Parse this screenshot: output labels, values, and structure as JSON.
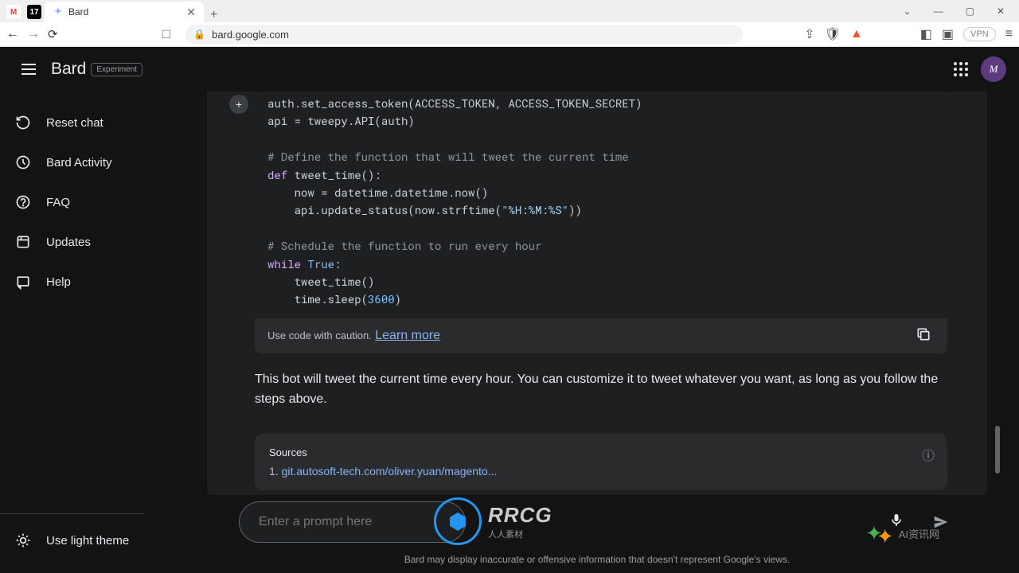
{
  "browser": {
    "tab_title": "Bard",
    "url": "bard.google.com",
    "vpn_label": "VPN"
  },
  "header": {
    "brand": "Bard",
    "badge": "Experiment",
    "avatar_letter": "M"
  },
  "sidebar": {
    "items": [
      {
        "label": "Reset chat"
      },
      {
        "label": "Bard Activity"
      },
      {
        "label": "FAQ"
      },
      {
        "label": "Updates"
      },
      {
        "label": "Help"
      }
    ],
    "theme_label": "Use light theme"
  },
  "code": {
    "line1a": "auth.set_access_token(ACCESS_TOKEN, ACCESS_TOKEN_SECRET)",
    "line2": "api = tweepy.API(auth)",
    "comment1": "# Define the function that will tweet the current time",
    "def_kw": "def",
    "func_name": " tweet_time():",
    "line5": "    now = datetime.datetime.now()",
    "line6a": "    api.update_status(now.strftime(",
    "line6_str": "\"%H:%M:%S\"",
    "line6b": "))",
    "comment2": "# Schedule the function to run every hour",
    "while_kw": "while",
    "true_kw": " True",
    "colon": ":",
    "line9": "    tweet_time()",
    "line10a": "    time.sleep(",
    "line10_num": "3600",
    "line10b": ")"
  },
  "code_footer": {
    "caution": "Use code with caution.",
    "learn": "Learn more"
  },
  "response": {
    "text": "This bot will tweet the current time every hour. You can customize it to tweet whatever you want, as long as you follow the steps above."
  },
  "sources": {
    "title": "Sources",
    "prefix": "1. ",
    "link": "git.autosoft-tech.com/oliver.yuan/magento..."
  },
  "input": {
    "placeholder": "Enter a prompt here"
  },
  "disclaimer": {
    "text": "Bard may display inaccurate or offensive information that doesn't represent Google's views."
  },
  "watermarks": {
    "rrcg": "RRCG",
    "rrcg_sub": "人人素材",
    "ai": "AI资讯网"
  }
}
